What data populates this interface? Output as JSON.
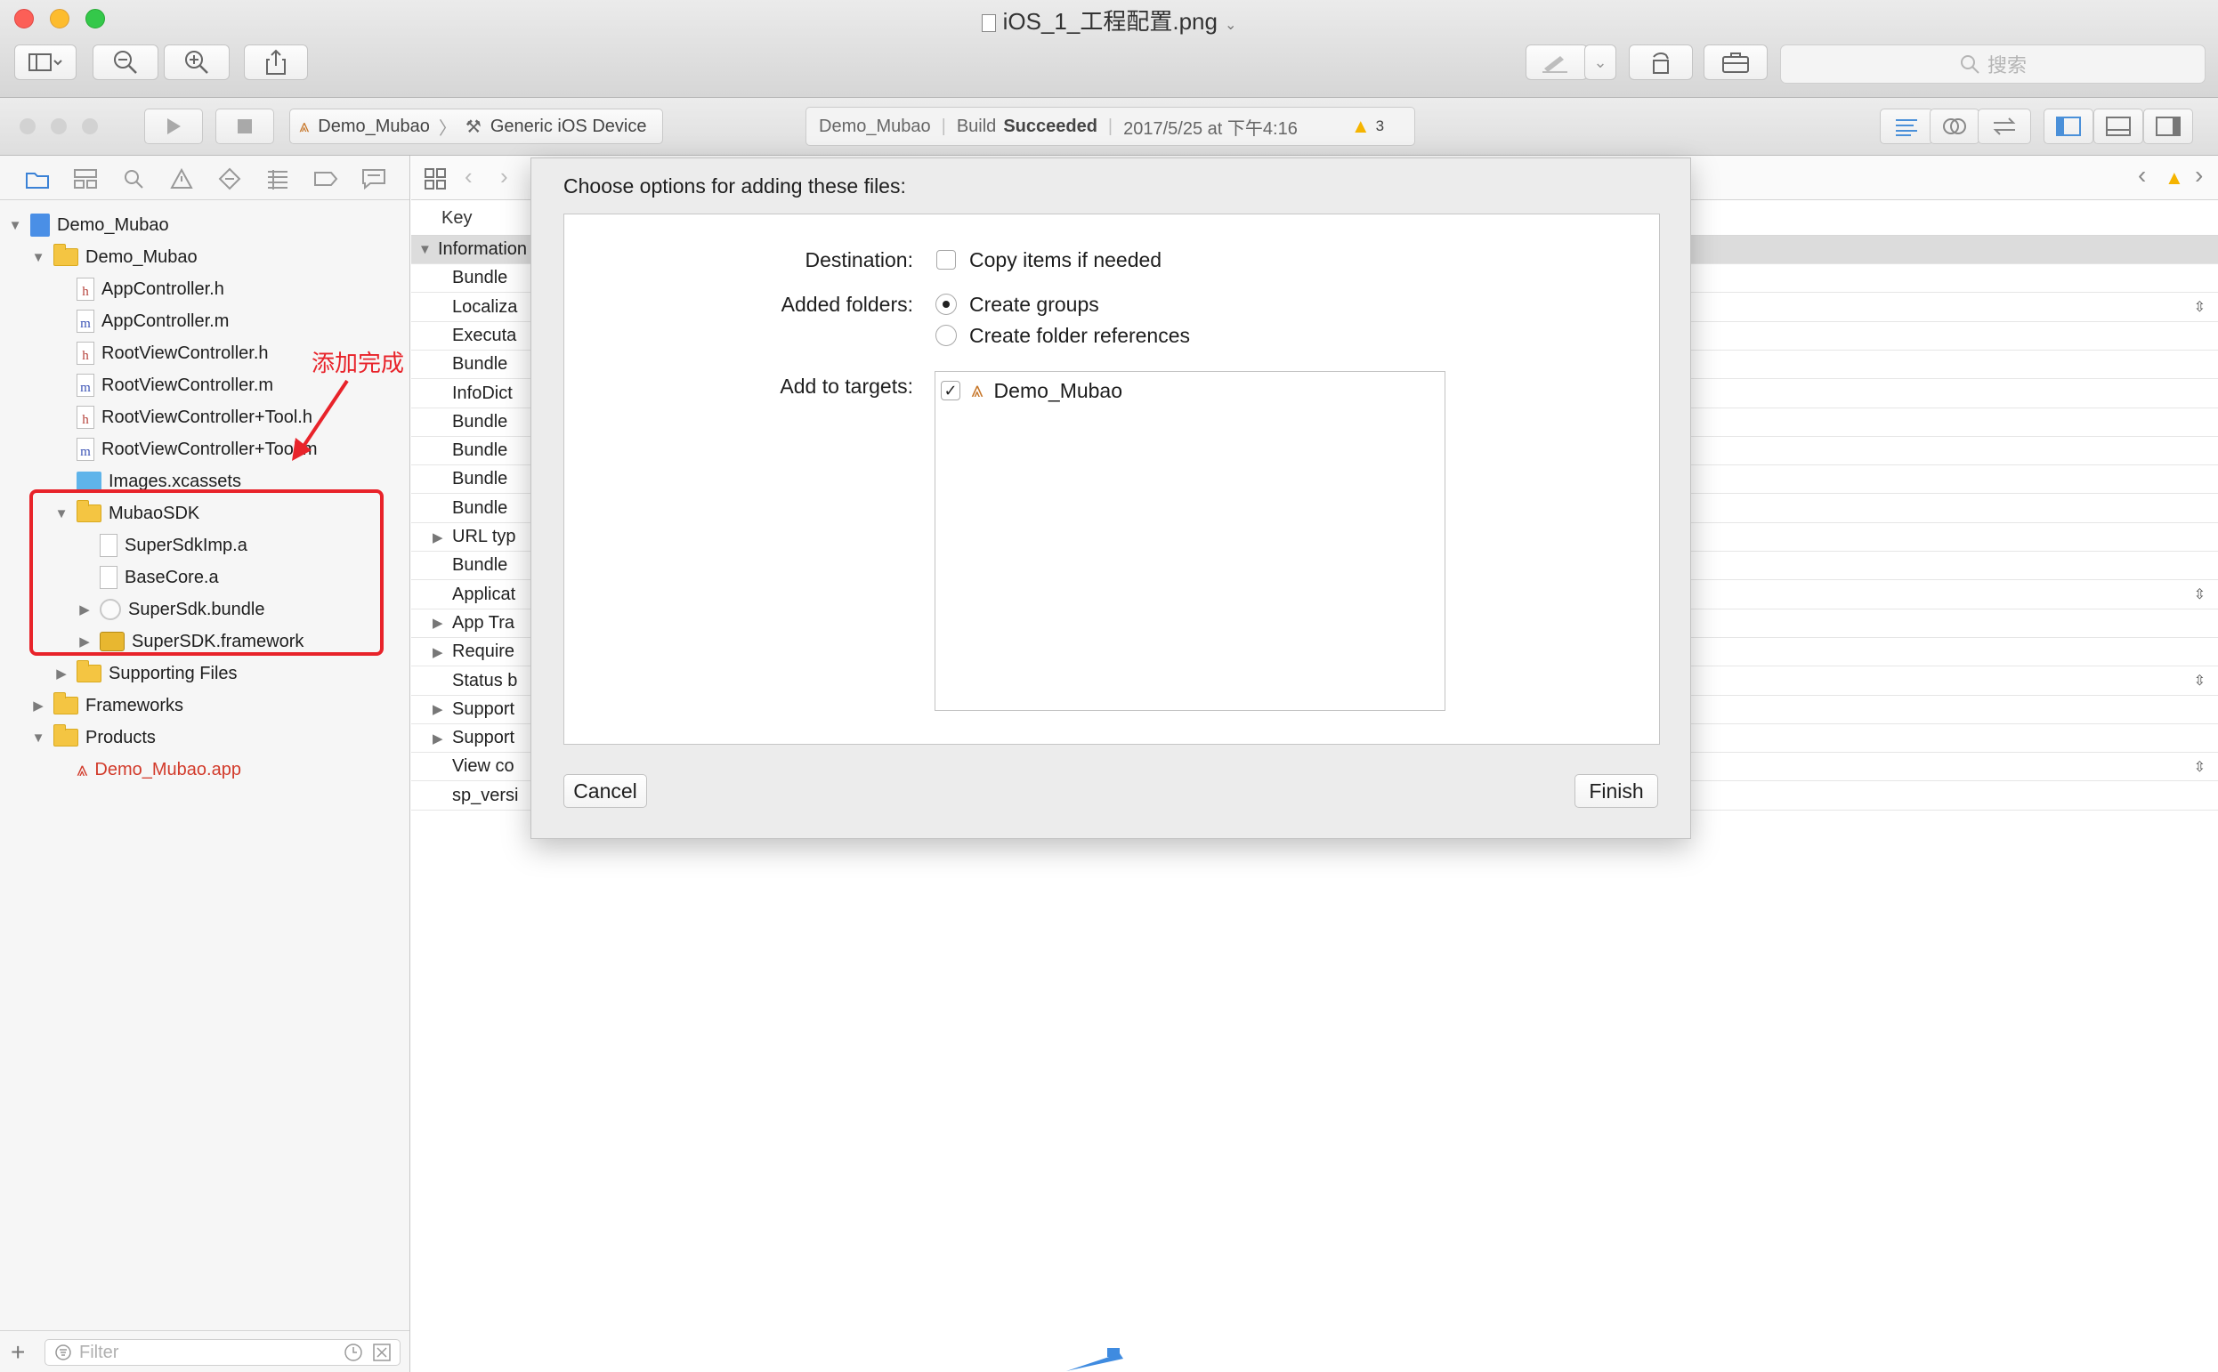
{
  "window": {
    "title": "iOS_1_工程配置.png",
    "search_placeholder": "搜索"
  },
  "xcode_toolbar": {
    "scheme": "Demo_Mubao",
    "device": "Generic iOS Device",
    "activity": {
      "project": "Demo_Mubao",
      "status_prefix": "Build",
      "status": "Succeeded",
      "timestamp": "2017/5/25 at 下午4:16",
      "warning_count": "3"
    }
  },
  "navigator": {
    "tree": [
      {
        "label": "Demo_Mubao",
        "icon": "project-icon",
        "indent": 0,
        "disclosure": "▼"
      },
      {
        "label": "Demo_Mubao",
        "icon": "folder-icon",
        "indent": 1,
        "disclosure": "▼"
      },
      {
        "label": "AppController.h",
        "icon": "header-file-icon",
        "indent": 2,
        "disclosure": ""
      },
      {
        "label": "AppController.m",
        "icon": "source-file-icon",
        "indent": 2,
        "disclosure": ""
      },
      {
        "label": "RootViewController.h",
        "icon": "header-file-icon",
        "indent": 2,
        "disclosure": ""
      },
      {
        "label": "RootViewController.m",
        "icon": "source-file-icon",
        "indent": 2,
        "disclosure": ""
      },
      {
        "label": "RootViewController+Tool.h",
        "icon": "header-file-icon",
        "indent": 2,
        "disclosure": ""
      },
      {
        "label": "RootViewController+Tool.m",
        "icon": "source-file-icon",
        "indent": 2,
        "disclosure": ""
      },
      {
        "label": "Images.xcassets",
        "icon": "asset-catalog-icon",
        "indent": 2,
        "disclosure": ""
      },
      {
        "label": "MubaoSDK",
        "icon": "folder-icon",
        "indent": 2,
        "disclosure": "▼"
      },
      {
        "label": "SuperSdkImp.a",
        "icon": "library-file-icon",
        "indent": 3,
        "disclosure": ""
      },
      {
        "label": "BaseCore.a",
        "icon": "library-file-icon",
        "indent": 3,
        "disclosure": ""
      },
      {
        "label": "SuperSdk.bundle",
        "icon": "bundle-icon",
        "indent": 3,
        "disclosure": "▶"
      },
      {
        "label": "SuperSDK.framework",
        "icon": "framework-icon",
        "indent": 3,
        "disclosure": "▶"
      },
      {
        "label": "Supporting Files",
        "icon": "folder-icon",
        "indent": 2,
        "disclosure": "▶"
      },
      {
        "label": "Frameworks",
        "icon": "folder-icon",
        "indent": 1,
        "disclosure": "▶"
      },
      {
        "label": "Products",
        "icon": "folder-icon",
        "indent": 1,
        "disclosure": "▼"
      },
      {
        "label": "Demo_Mubao.app",
        "icon": "app-product-icon",
        "indent": 2,
        "disclosure": "",
        "color": "#d23b2b"
      }
    ],
    "filter_placeholder": "Filter"
  },
  "annotation": {
    "text": "添加完成",
    "color": "#e8232a"
  },
  "plist": {
    "key_header": "Key",
    "rows": [
      {
        "disclosure": "▼",
        "key": "Information",
        "indent": 0,
        "highlight": true
      },
      {
        "disclosure": "",
        "key": "Bundle",
        "indent": 1
      },
      {
        "disclosure": "",
        "key": "Localiza",
        "indent": 1,
        "stepper": true
      },
      {
        "disclosure": "",
        "key": "Executa",
        "indent": 1
      },
      {
        "disclosure": "",
        "key": "Bundle",
        "indent": 1
      },
      {
        "disclosure": "",
        "key": "InfoDict",
        "indent": 1
      },
      {
        "disclosure": "",
        "key": "Bundle",
        "indent": 1
      },
      {
        "disclosure": "",
        "key": "Bundle",
        "indent": 1
      },
      {
        "disclosure": "",
        "key": "Bundle",
        "indent": 1
      },
      {
        "disclosure": "",
        "key": "Bundle",
        "indent": 1
      },
      {
        "disclosure": "▶",
        "key": "URL typ",
        "indent": 1
      },
      {
        "disclosure": "",
        "key": "Bundle",
        "indent": 1
      },
      {
        "disclosure": "",
        "key": "Applicat",
        "indent": 1,
        "stepper": true
      },
      {
        "disclosure": "▶",
        "key": "App Tra",
        "indent": 1
      },
      {
        "disclosure": "▶",
        "key": "Require",
        "indent": 1
      },
      {
        "disclosure": "",
        "key": "Status b",
        "indent": 1,
        "stepper": true
      },
      {
        "disclosure": "▶",
        "key": "Support",
        "indent": 1
      },
      {
        "disclosure": "▶",
        "key": "Support",
        "indent": 1
      },
      {
        "disclosure": "",
        "key": "View co",
        "indent": 1,
        "stepper": true
      },
      {
        "disclosure": "",
        "key": "sp_versi",
        "indent": 1
      }
    ]
  },
  "sheet": {
    "title": "Choose options for adding these files:",
    "destination_label": "Destination:",
    "copy_items_label": "Copy items if needed",
    "copy_items_checked": false,
    "added_folders_label": "Added folders:",
    "create_groups_label": "Create groups",
    "create_folder_refs_label": "Create folder references",
    "selected_folder_option": "Create groups",
    "add_to_targets_label": "Add to targets:",
    "targets": [
      {
        "name": "Demo_Mubao",
        "checked": true,
        "checkmark": "✓"
      }
    ],
    "cancel_label": "Cancel",
    "finish_label": "Finish"
  }
}
